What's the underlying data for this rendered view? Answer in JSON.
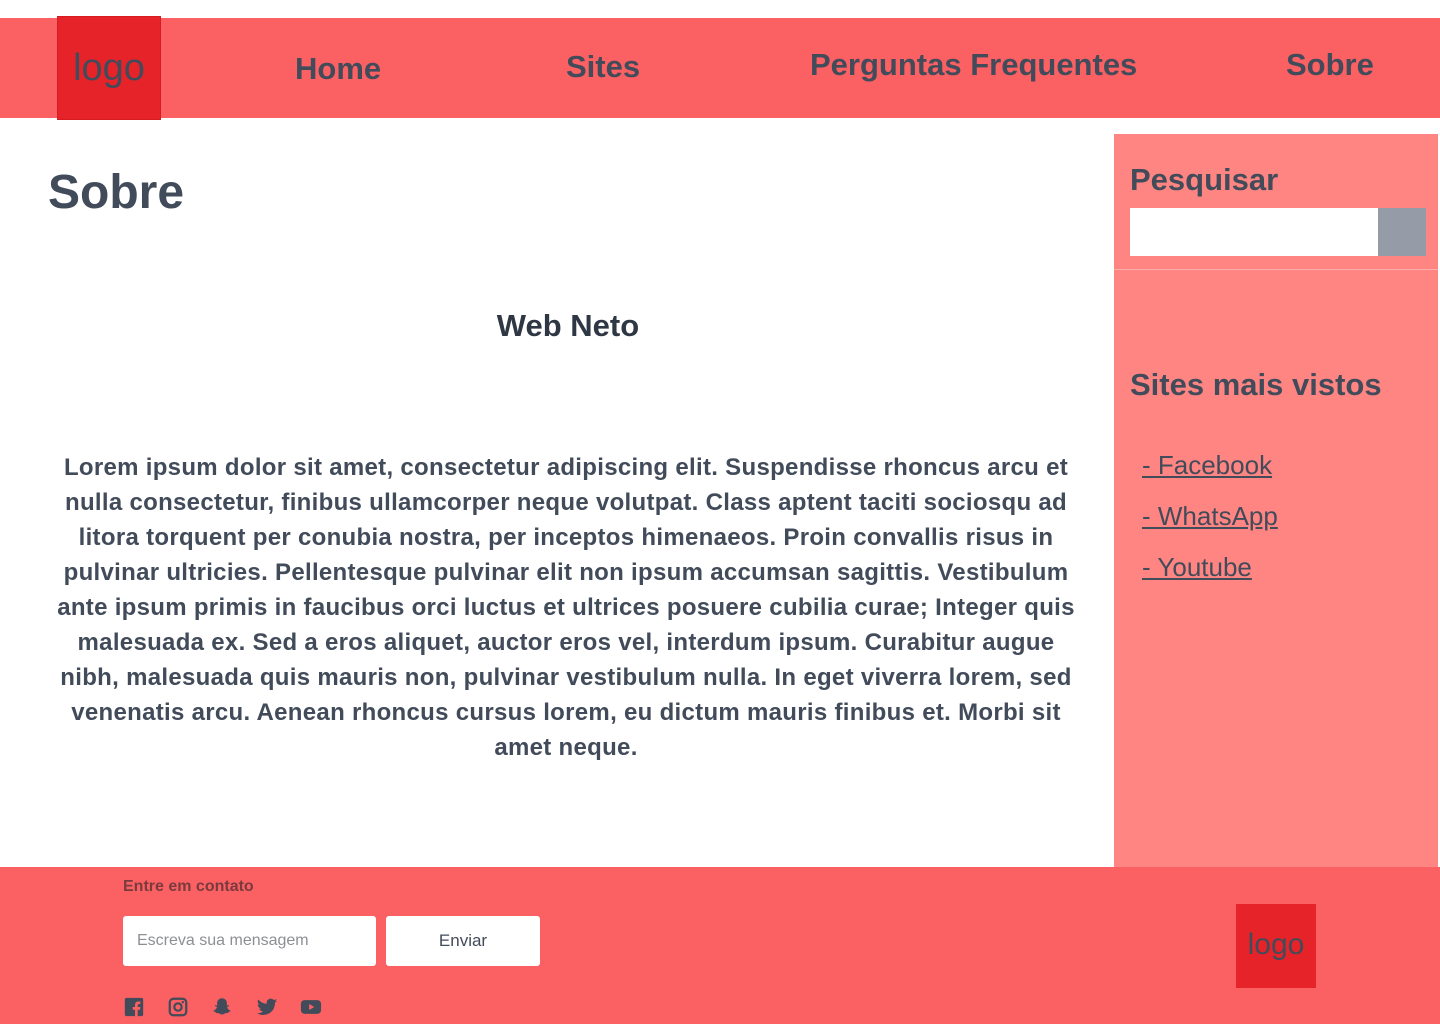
{
  "header": {
    "logo_text": "logo",
    "nav": [
      {
        "label": "Home"
      },
      {
        "label": "Sites"
      },
      {
        "label": "Perguntas Frequentes"
      },
      {
        "label": "Sobre"
      }
    ]
  },
  "main": {
    "title": "Sobre",
    "subtitle": "Web Neto",
    "body": "Lorem ipsum dolor sit amet, consectetur adipiscing elit. Suspendisse rhoncus arcu et nulla consectetur, finibus ullamcorper neque volutpat. Class aptent taciti sociosqu ad litora torquent per conubia nostra, per inceptos himenaeos. Proin convallis risus in pulvinar ultricies. Pellentesque pulvinar elit non ipsum accumsan sagittis. Vestibulum ante ipsum primis in faucibus orci luctus et ultrices posuere cubilia curae; Integer quis malesuada ex. Sed a eros aliquet, auctor eros vel, interdum ipsum. Curabitur augue nibh, malesuada quis mauris non, pulvinar vestibulum nulla. In eget viverra lorem, sed venenatis arcu. Aenean rhoncus cursus lorem, eu dictum mauris finibus et. Morbi sit amet neque."
  },
  "sidebar": {
    "search_heading": "Pesquisar",
    "search_value": "",
    "top_sites_heading": "Sites mais vistos",
    "top_sites": [
      {
        "label": "- Facebook"
      },
      {
        "label": "- WhatsApp"
      },
      {
        "label": "- Youtube"
      }
    ]
  },
  "footer": {
    "contact_heading": "Entre em contato",
    "message_placeholder": "Escreva sua mensagem",
    "send_label": "Enviar",
    "social_icons": [
      "facebook-icon",
      "instagram-icon",
      "snapchat-icon",
      "twitter-icon",
      "youtube-icon"
    ],
    "logo_text": "logo"
  },
  "colors": {
    "header_bg": "#fb6063",
    "logo_bg": "#e52329",
    "sidebar_bg": "#ff8582",
    "search_button": "#959ca8",
    "text": "#424b5a"
  }
}
